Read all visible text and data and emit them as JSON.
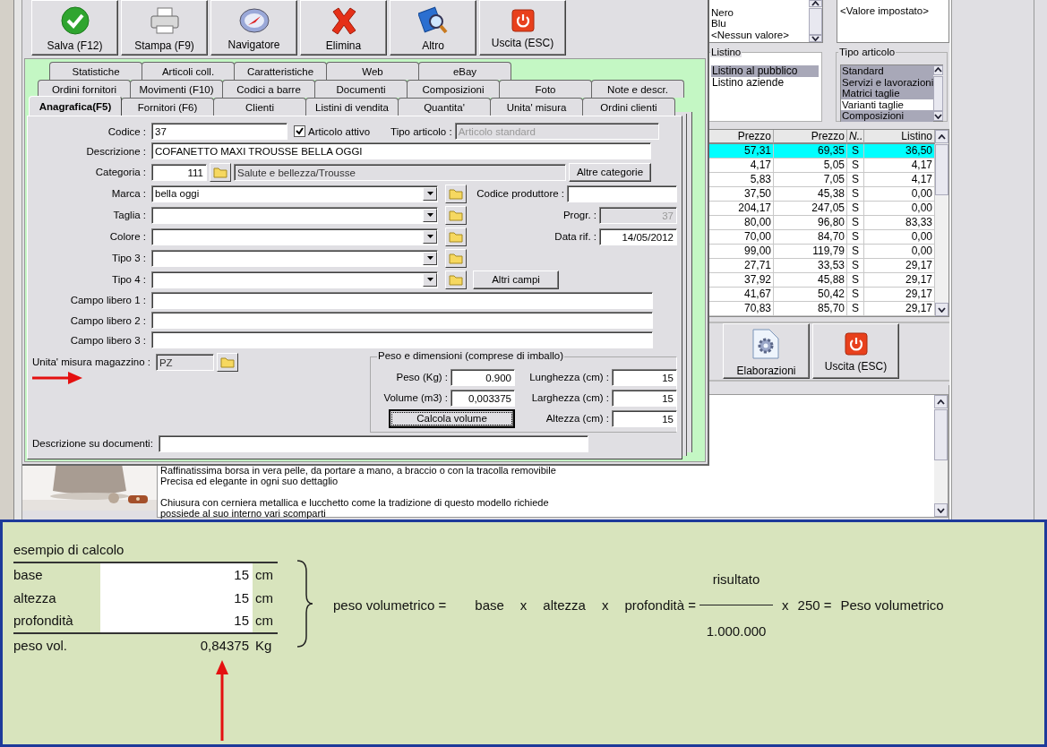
{
  "color_list": {
    "items": [
      "Nero",
      "Blu",
      "<Nessun valore>"
    ]
  },
  "value_list": {
    "items": [
      "<Valore impostato>"
    ]
  },
  "listino": {
    "title": "Listino",
    "items": [
      {
        "label": "Listino al pubblico",
        "selected": true
      },
      {
        "label": "Listino aziende",
        "selected": false
      }
    ]
  },
  "tipo_articolo_filter": {
    "title": "Tipo articolo",
    "items": [
      {
        "label": "Standard",
        "selected": true
      },
      {
        "label": "Servizi e lavorazioni",
        "selected": true
      },
      {
        "label": "Matrici taglie",
        "selected": true
      },
      {
        "label": "Varianti taglie",
        "selected": false
      },
      {
        "label": "Composizioni",
        "selected": true
      }
    ]
  },
  "price_table": {
    "columns": [
      "Prezzo",
      "Prezzo",
      "N..",
      "Listino"
    ],
    "rows": [
      {
        "cells": [
          "57,31",
          "69,35",
          "S",
          "36,50"
        ],
        "selected": true
      },
      {
        "cells": [
          "4,17",
          "5,05",
          "S",
          "4,17"
        ],
        "selected": false
      },
      {
        "cells": [
          "5,83",
          "7,05",
          "S",
          "4,17"
        ],
        "selected": false
      },
      {
        "cells": [
          "37,50",
          "45,38",
          "S",
          "0,00"
        ],
        "selected": false
      },
      {
        "cells": [
          "204,17",
          "247,05",
          "S",
          "0,00"
        ],
        "selected": false
      },
      {
        "cells": [
          "80,00",
          "96,80",
          "S",
          "83,33"
        ],
        "selected": false
      },
      {
        "cells": [
          "70,00",
          "84,70",
          "S",
          "0,00"
        ],
        "selected": false
      },
      {
        "cells": [
          "99,00",
          "119,79",
          "S",
          "0,00"
        ],
        "selected": false
      },
      {
        "cells": [
          "27,71",
          "33,53",
          "S",
          "29,17"
        ],
        "selected": false
      },
      {
        "cells": [
          "37,92",
          "45,88",
          "S",
          "29,17"
        ],
        "selected": false
      },
      {
        "cells": [
          "41,67",
          "50,42",
          "S",
          "29,17"
        ],
        "selected": false
      },
      {
        "cells": [
          "70,83",
          "85,70",
          "S",
          "29,17"
        ],
        "selected": false
      }
    ]
  },
  "actions": [
    "Elaborazioni",
    "Uscita (ESC)"
  ],
  "description": {
    "paragraphs": [
      [
        "Raffinatissima borsa in vera pelle, da portare a mano, a braccio o con la tracolla removibile",
        "Precisa ed elegante in ogni suo dettaglio"
      ],
      [
        "Chiusura con cerniera metallica e lucchetto come la tradizione di questo modello richiede",
        "possiede al suo interno vari scomparti"
      ]
    ]
  },
  "dialog": {
    "toolbar": [
      "Salva (F12)",
      "Stampa (F9)",
      "Navigatore",
      "Elimina",
      "Altro",
      "Uscita (ESC)"
    ],
    "tab_rows": [
      [
        {
          "label": "Statistiche",
          "selected": false
        },
        {
          "label": "Articoli coll.",
          "selected": false
        },
        {
          "label": "Caratteristiche",
          "selected": false
        },
        {
          "label": "Web",
          "selected": false
        },
        {
          "label": "eBay",
          "selected": false
        }
      ],
      [
        {
          "label": "Ordini fornitori",
          "selected": false
        },
        {
          "label": "Movimenti (F10)",
          "selected": false
        },
        {
          "label": "Codici a barre",
          "selected": false
        },
        {
          "label": "Documenti",
          "selected": false
        },
        {
          "label": "Composizioni",
          "selected": false
        },
        {
          "label": "Foto",
          "selected": false
        },
        {
          "label": "Note e descr.",
          "selected": false
        }
      ],
      [
        {
          "label": "Anagrafica(F5)",
          "selected": true
        },
        {
          "label": "Fornitori (F6)",
          "selected": false
        },
        {
          "label": "Clienti",
          "selected": false
        },
        {
          "label": "Listini di vendita",
          "selected": false
        },
        {
          "label": "Quantita'",
          "selected": false
        },
        {
          "label": "Unita' misura",
          "selected": false
        },
        {
          "label": "Ordini clienti",
          "selected": false
        }
      ]
    ],
    "form": {
      "codice": {
        "label": "Codice :",
        "value": "37"
      },
      "attivo": {
        "label": "Articolo attivo",
        "checked": true
      },
      "tipo_articolo": {
        "label": "Tipo articolo :",
        "value": "Articolo standard",
        "disabled": true
      },
      "descrizione": {
        "label": "Descrizione :",
        "value": "COFANETTO MAXI TROUSSE BELLA OGGI"
      },
      "categoria": {
        "label": "Categoria :",
        "code": "111",
        "name": "Salute e bellezza/Trousse",
        "button": "Altre categorie"
      },
      "combos": [
        {
          "label": "Marca :",
          "value": "bella oggi"
        },
        {
          "label": "Taglia :"
        },
        {
          "label": "Colore :"
        },
        {
          "label": "Tipo 3 :"
        },
        {
          "label": "Tipo 4 :"
        }
      ],
      "side_fields": [
        {
          "label": "Codice produttore :",
          "disabled": false
        },
        {
          "label": "Progr. :",
          "value": "37",
          "disabled": true
        },
        {
          "label": "Data rif. :",
          "value": "14/05/2012",
          "disabled": false
        }
      ],
      "altri_campi": "Altri campi",
      "campi_liberi": [
        {
          "label": "Campo libero 1 :"
        },
        {
          "label": "Campo libero 2 :"
        },
        {
          "label": "Campo libero 3 :"
        }
      ],
      "unita_misura": {
        "label": "Unita' misura magazzino :",
        "value": "PZ"
      },
      "peso_dimensioni": {
        "title": "Peso e dimensioni (comprese di imballo)",
        "left": [
          {
            "label": "Peso (Kg) :",
            "value": "0.900"
          },
          {
            "label": "Volume (m3) :",
            "value": "0,003375"
          }
        ],
        "right": [
          {
            "label": "Lunghezza (cm) :",
            "value": "15"
          },
          {
            "label": "Larghezza (cm) :",
            "value": "15"
          },
          {
            "label": "Altezza (cm) :",
            "value": "15"
          }
        ],
        "button": "Calcola volume"
      },
      "descrizione_documenti": {
        "label": "Descrizione su documenti:"
      }
    }
  },
  "example": {
    "title": "esempio di calcolo",
    "rows": [
      {
        "label": "base",
        "value": "15",
        "unit": "cm"
      },
      {
        "label": "altezza",
        "value": "15",
        "unit": "cm"
      },
      {
        "label": "profondità",
        "value": "15",
        "unit": "cm"
      }
    ],
    "result": {
      "label": "peso vol.",
      "value": "0,84375",
      "unit": "Kg"
    },
    "formula": {
      "lhs": "peso volumetrico =",
      "terms": [
        "base",
        "x",
        "altezza",
        "x",
        "profondità ="
      ],
      "numerator": "risultato",
      "denominator": "1.000.000",
      "tail": [
        "x",
        "250 =",
        "Peso volumetrico"
      ]
    }
  }
}
